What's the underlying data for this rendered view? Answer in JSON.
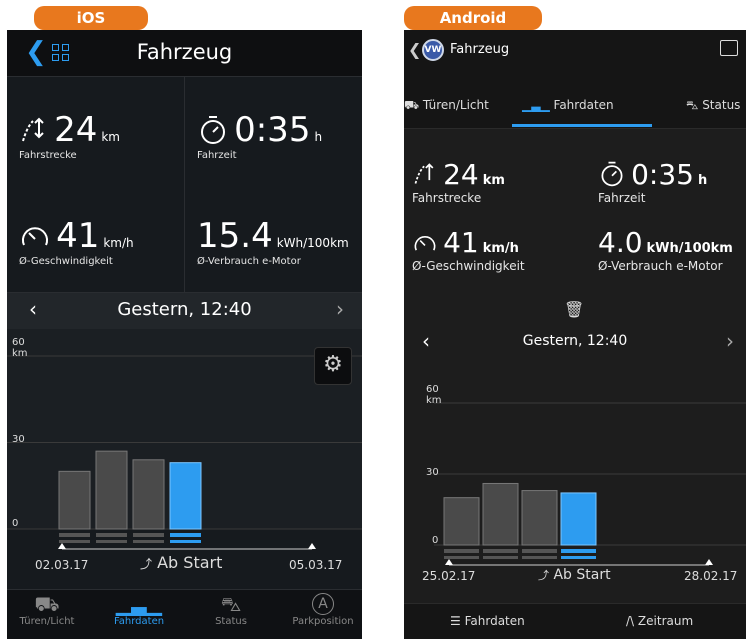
{
  "labels": {
    "ios": "iOS",
    "android": "Android"
  },
  "ios": {
    "title": "Fahrzeug",
    "back_glyph": "❮",
    "stats": [
      {
        "value": "24",
        "unit": "km",
        "label": "Fahrstrecke"
      },
      {
        "value": "0:35",
        "unit": "h",
        "label": "Fahrzeit"
      },
      {
        "value": "41",
        "unit": "km/h",
        "label": "Ø-Geschwindigkeit"
      },
      {
        "value": "15.4",
        "unit": "kWh/100km",
        "label": "Ø-Verbrauch e-Motor"
      }
    ],
    "date": "Gestern, 12:40",
    "prev": "‹",
    "next": "›",
    "axis": {
      "top": "60",
      "top_unit": "km",
      "mid": "30",
      "zero": "0"
    },
    "x_start": "02.03.17",
    "x_end": "05.03.17",
    "x_center": "Ab Start",
    "tabs": [
      "Türen/Licht",
      "Fahrdaten",
      "Status",
      "Parkposition"
    ],
    "gear_glyph": "⚙",
    "park_glyph": "A"
  },
  "android": {
    "title": "Fahrzeug",
    "logo": "VW",
    "back": "❮",
    "tabs": [
      "Türen/Licht",
      "Fahrdaten",
      "Status"
    ],
    "stats": [
      {
        "value": "24",
        "unit": "km",
        "label": "Fahrstrecke"
      },
      {
        "value": "0:35",
        "unit": "h",
        "label": "Fahrzeit"
      },
      {
        "value": "41",
        "unit": "km/h",
        "label": "Ø-Geschwindigkeit"
      },
      {
        "value": "4.0",
        "unit": "kWh/100km",
        "label": "Ø-Verbrauch e-Motor"
      }
    ],
    "trash_glyph": "🗑",
    "date": "Gestern, 12:40",
    "prev": "‹",
    "next": "›",
    "axis": {
      "top": "60",
      "top_unit": "km",
      "mid": "30",
      "zero": "0"
    },
    "x_start": "25.02.17",
    "x_end": "28.02.17",
    "x_center": "Ab Start",
    "bottom": [
      "Fahrdaten",
      "Zeitraum"
    ]
  },
  "colors": {
    "accent": "#2d9cf0",
    "bar": "#4a4a4a",
    "tab_orange": "#e8781e"
  },
  "chart_data": [
    {
      "type": "bar",
      "categories": [
        "1",
        "2",
        "3",
        "4"
      ],
      "values": [
        20,
        27,
        24,
        23
      ],
      "highlight_index": 3,
      "ylim": [
        0,
        60
      ],
      "ylabel": "km"
    },
    {
      "type": "bar",
      "categories": [
        "1",
        "2",
        "3",
        "4"
      ],
      "values": [
        20,
        26,
        23,
        22
      ],
      "highlight_index": 3,
      "ylim": [
        0,
        60
      ],
      "ylabel": "km"
    }
  ]
}
